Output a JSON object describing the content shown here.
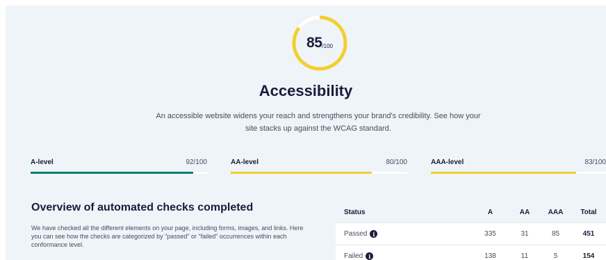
{
  "score": {
    "value": "85",
    "max": "/100",
    "fraction": 0.85
  },
  "heading": {
    "title": "Accessibility",
    "description": "An accessible website widens your reach and strengthens your brand's credibility. See how your site stacks up against the WCAG standard."
  },
  "levels": [
    {
      "name": "A-level",
      "score": "92/100",
      "fraction": 0.92,
      "color": "#0f7d6d"
    },
    {
      "name": "AA-level",
      "score": "80/100",
      "fraction": 0.8,
      "color": "#f2cf2c"
    },
    {
      "name": "AAA-level",
      "score": "83/100",
      "fraction": 0.83,
      "color": "#f2cf2c"
    }
  ],
  "overview": {
    "title": "Overview of automated checks completed",
    "text": "We have checked all the different elements on your page, including forms, images, and links. Here you can see how the checks are categorized by \"passed\" or \"failed\" occurrences within each conformance level."
  },
  "table": {
    "headers": {
      "status": "Status",
      "a": "A",
      "aa": "AA",
      "aaa": "AAA",
      "total": "Total"
    },
    "rows": [
      {
        "status": "Passed",
        "a": "335",
        "aa": "31",
        "aaa": "85",
        "total": "451"
      },
      {
        "status": "Failed",
        "a": "138",
        "aa": "11",
        "aaa": "5",
        "total": "154"
      }
    ]
  },
  "colors": {
    "ring": "#f2cf2c",
    "ring_track": "#ffffff",
    "navy": "#1b1b3a",
    "background": "#eef4f8"
  }
}
